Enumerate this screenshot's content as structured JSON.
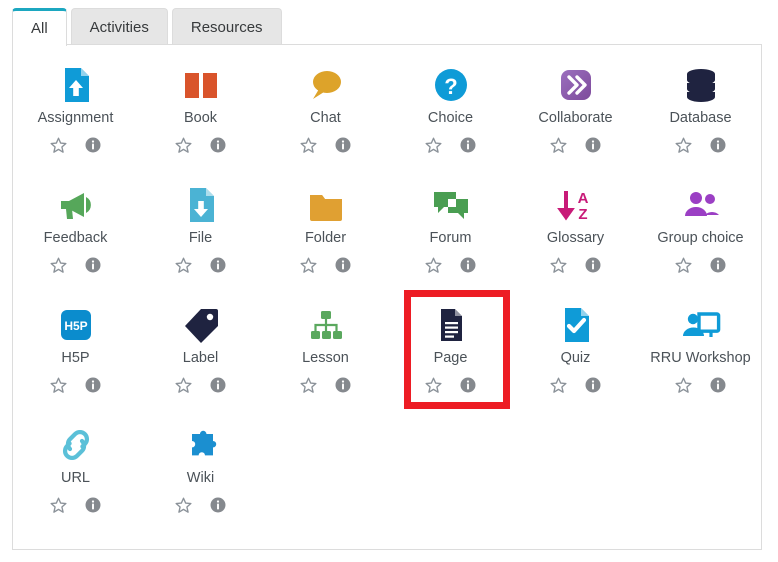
{
  "tabs": [
    {
      "label": "All",
      "active": true
    },
    {
      "label": "Activities",
      "active": false
    },
    {
      "label": "Resources",
      "active": false
    }
  ],
  "accent_color": "#1ca7c0",
  "highlight_color": "#ed1c24",
  "action_icons": {
    "star": "star-outline-icon",
    "info": "info-circle-icon"
  },
  "activity_chooser": {
    "items": [
      {
        "label": "Assignment",
        "icon": "assignment-upload-icon",
        "color": "#0f9bd7",
        "highlighted": false
      },
      {
        "label": "Book",
        "icon": "book-open-icon",
        "color": "#d9542b",
        "highlighted": false
      },
      {
        "label": "Chat",
        "icon": "chat-bubble-icon",
        "color": "#dda32a",
        "highlighted": false
      },
      {
        "label": "Choice",
        "icon": "question-circle-icon",
        "color": "#0f9bd7",
        "highlighted": false
      },
      {
        "label": "Collaborate",
        "icon": "collaborate-chevrons-icon",
        "color": "#8a55a8",
        "highlighted": false
      },
      {
        "label": "Database",
        "icon": "database-cylinder-icon",
        "color": "#1f2340",
        "highlighted": false
      },
      {
        "label": "Feedback",
        "icon": "megaphone-icon",
        "color": "#56a75a",
        "highlighted": false
      },
      {
        "label": "File",
        "icon": "file-download-icon",
        "color": "#4bb3d4",
        "highlighted": false
      },
      {
        "label": "Folder",
        "icon": "folder-icon",
        "color": "#e0a032",
        "highlighted": false
      },
      {
        "label": "Forum",
        "icon": "forum-bubbles-icon",
        "color": "#4a9e52",
        "highlighted": false
      },
      {
        "label": "Glossary",
        "icon": "sort-alpha-az-icon",
        "color": "#c81a78",
        "highlighted": false
      },
      {
        "label": "Group choice",
        "icon": "users-group-icon",
        "color": "#9b3fc4",
        "highlighted": false
      },
      {
        "label": "H5P",
        "icon": "h5p-badge-icon",
        "color": "#0b8ccd",
        "highlighted": false
      },
      {
        "label": "Label",
        "icon": "tag-icon",
        "color": "#1f2340",
        "highlighted": false
      },
      {
        "label": "Lesson",
        "icon": "sitemap-icon",
        "color": "#5aa85e",
        "highlighted": false
      },
      {
        "label": "Page",
        "icon": "page-document-icon",
        "color": "#1f2340",
        "highlighted": true
      },
      {
        "label": "Quiz",
        "icon": "quiz-check-icon",
        "color": "#0f9bd7",
        "highlighted": false
      },
      {
        "label": "RRU Workshop",
        "icon": "workshop-presenter-icon",
        "color": "#0f9bd7",
        "highlighted": false
      },
      {
        "label": "URL",
        "icon": "link-chain-icon",
        "color": "#5bc0d8",
        "highlighted": false
      },
      {
        "label": "Wiki",
        "icon": "puzzle-piece-icon",
        "color": "#1b8fd0",
        "highlighted": false
      }
    ]
  }
}
